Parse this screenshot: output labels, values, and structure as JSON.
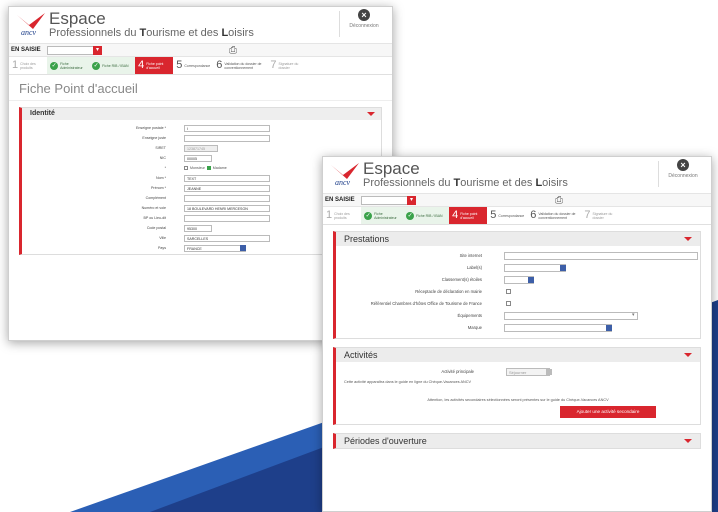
{
  "colors": {
    "accent": "#d9262e",
    "done": "#3aa24a",
    "dark_blue": "#1e3f8a",
    "mid_blue": "#2b5fb5"
  },
  "brand": {
    "logo": "ancv",
    "title": "Espace",
    "subtitle_parts": [
      "Professionnels du ",
      "T",
      "ourisme et des ",
      "L",
      "oisirs"
    ]
  },
  "logout": {
    "label": "Déconnexion",
    "icon": "close-circle-icon"
  },
  "status_bar": {
    "label": "EN SAISIE",
    "select_value": "",
    "print_icon": "print-icon"
  },
  "steps": [
    {
      "n": "1",
      "label": "Choix des produits",
      "state": "todo"
    },
    {
      "n": "",
      "label": "Fiche Administrateur",
      "state": "done"
    },
    {
      "n": "",
      "label": "Fiche RIB / IBAN",
      "state": "done"
    },
    {
      "n": "4",
      "label": "Fiche point d'accueil",
      "state": "active"
    },
    {
      "n": "5",
      "label": "Correspondance",
      "state": "next"
    },
    {
      "n": "6",
      "label": "Validation du dossier de conventionnement",
      "state": "next"
    },
    {
      "n": "7",
      "label": "Signature du dossier",
      "state": "todo"
    }
  ],
  "page_title": "Fiche Point d'accueil",
  "identity": {
    "title": "Identité",
    "fields": [
      {
        "label": "Enseigne postale *",
        "value": "I",
        "kind": "w"
      },
      {
        "label": "Enseigne juste",
        "value": "",
        "kind": "w"
      },
      {
        "label": "SIRET",
        "value": "123871745",
        "kind": "g"
      },
      {
        "label": "NIC",
        "value": "00005",
        "kind": "s"
      },
      {
        "label": "*",
        "value": "",
        "kind": "radio"
      },
      {
        "label": "Nom *",
        "value": "TEXT",
        "kind": "w"
      },
      {
        "label": "Prénom *",
        "value": "JEANNE",
        "kind": "w"
      },
      {
        "label": "Complément",
        "value": "",
        "kind": "w"
      },
      {
        "label": "Numéro et voie",
        "value": "18 BOULEVARD HENRI MERCESON",
        "kind": "w"
      },
      {
        "label": "BP ou Lieu-dit",
        "value": "",
        "kind": "w"
      },
      {
        "label": "Code postal",
        "value": "95300",
        "kind": "s"
      },
      {
        "label": "Ville",
        "value": "SARCELLES",
        "kind": "w"
      },
      {
        "label": "Pays",
        "value": "FRANCE",
        "kind": "select"
      }
    ],
    "radio": {
      "opt1": "Monsieur",
      "opt2": "Madame"
    }
  },
  "prestations": {
    "title": "Prestations",
    "fields": [
      {
        "label": "Site internet",
        "kind": "wide"
      },
      {
        "label": "Label(s)",
        "kind": "select"
      },
      {
        "label": "Classement(s) étoiles",
        "kind": "selectsm"
      },
      {
        "label": "Réceptacle de déclaration en mairie",
        "kind": "check"
      },
      {
        "label": "Référentiel Chambres d'hôtes Office de Tourisme de France",
        "kind": "check"
      },
      {
        "label": "Équipements",
        "kind": "select2"
      },
      {
        "label": "Marque",
        "kind": "select"
      }
    ]
  },
  "activites": {
    "title": "Activités",
    "field_label": "Activité principale",
    "field_value": "Séjourner",
    "note1": "Cette activité apparaîtra dans le guide en ligne du Chèque-Vacances ANCV",
    "note2": "Attention, les activités secondaires sélectionnées seront présentes sur le guide du Chèque-Vacances ANCV",
    "add_button": "Ajouter une activité secondaire"
  },
  "periodes": {
    "title": "Périodes d'ouverture"
  }
}
